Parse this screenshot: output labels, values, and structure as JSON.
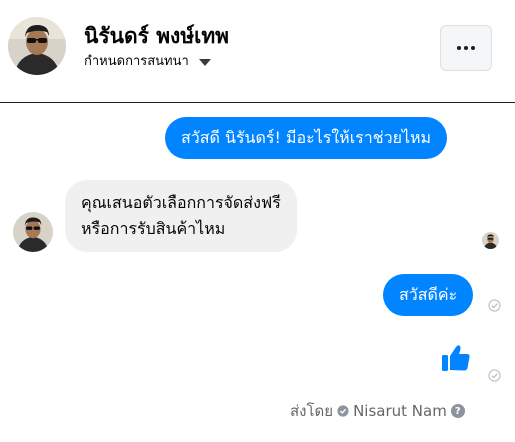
{
  "header": {
    "name": "นิรันดร์ พงษ์เทพ",
    "subtitle": "กำหนดการสนทนา"
  },
  "messages": {
    "m1": "สวัสดี นิรันดร์! มีอะไรให้เราช่วยไหม",
    "m2_line1": "คุณเสนอตัวเลือกการจัดส่งฟรี",
    "m2_line2": "หรือการรับสินค้าไหม",
    "m3": "สวัสดีค่ะ"
  },
  "footer": {
    "sent_by_label": "ส่งโดย",
    "sender_name": "Nisarut Nam",
    "help_glyph": "?"
  },
  "colors": {
    "outgoing_bubble": "#0084ff",
    "incoming_bubble": "#f0f0f0",
    "like_icon": "#0084ff"
  },
  "icons": {
    "more": "more-options-icon",
    "caret": "caret-down-icon",
    "like": "thumbs-up-icon",
    "check": "delivered-check-icon",
    "help": "help-icon"
  }
}
